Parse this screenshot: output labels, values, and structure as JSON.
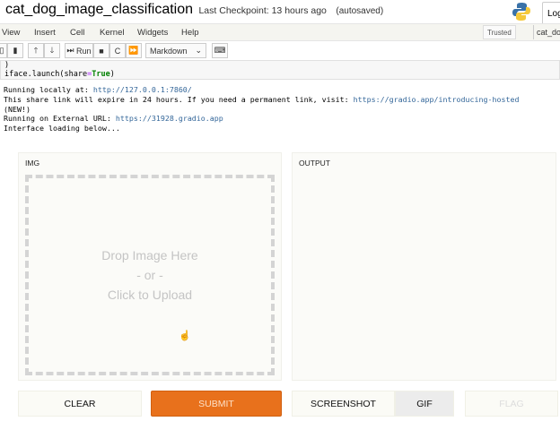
{
  "header": {
    "notebook_title": "cat_dog_image_classification",
    "checkpoint": "Last Checkpoint: 13 hours ago",
    "autosave": "(autosaved)",
    "login": "Log"
  },
  "menu": {
    "items": [
      "View",
      "Insert",
      "Cell",
      "Kernel",
      "Widgets",
      "Help"
    ],
    "trusted": "Trusted",
    "kernel": "cat_dog"
  },
  "toolbar": {
    "run": "Run",
    "cell_type": "Markdown"
  },
  "code": {
    "line1": ")",
    "line2_pre": "iface.launch(share",
    "line2_op": "=",
    "line2_kw": "True",
    "line2_post": ")"
  },
  "output": {
    "l1": "Running locally at: ",
    "l1_link": "http://127.0.0.1:7860/",
    "l2": "This share link will expire in 24 hours. If you need a permanent link, visit: ",
    "l2_link": "https://gradio.app/introducing-hosted",
    "l3": "(NEW!)",
    "l4": "Running on External URL: ",
    "l4_link": "https://31928.gradio.app",
    "l5": "Interface loading below..."
  },
  "gradio": {
    "input_label": "IMG",
    "output_label": "OUTPUT",
    "drop_line1": "Drop Image Here",
    "drop_line2": "- or -",
    "drop_line3": "Click to Upload",
    "buttons": {
      "clear": "CLEAR",
      "submit": "SUBMIT",
      "screenshot": "SCREENSHOT",
      "gif": "GIF",
      "flag": "FLAG"
    },
    "accent": "#e8711c"
  }
}
